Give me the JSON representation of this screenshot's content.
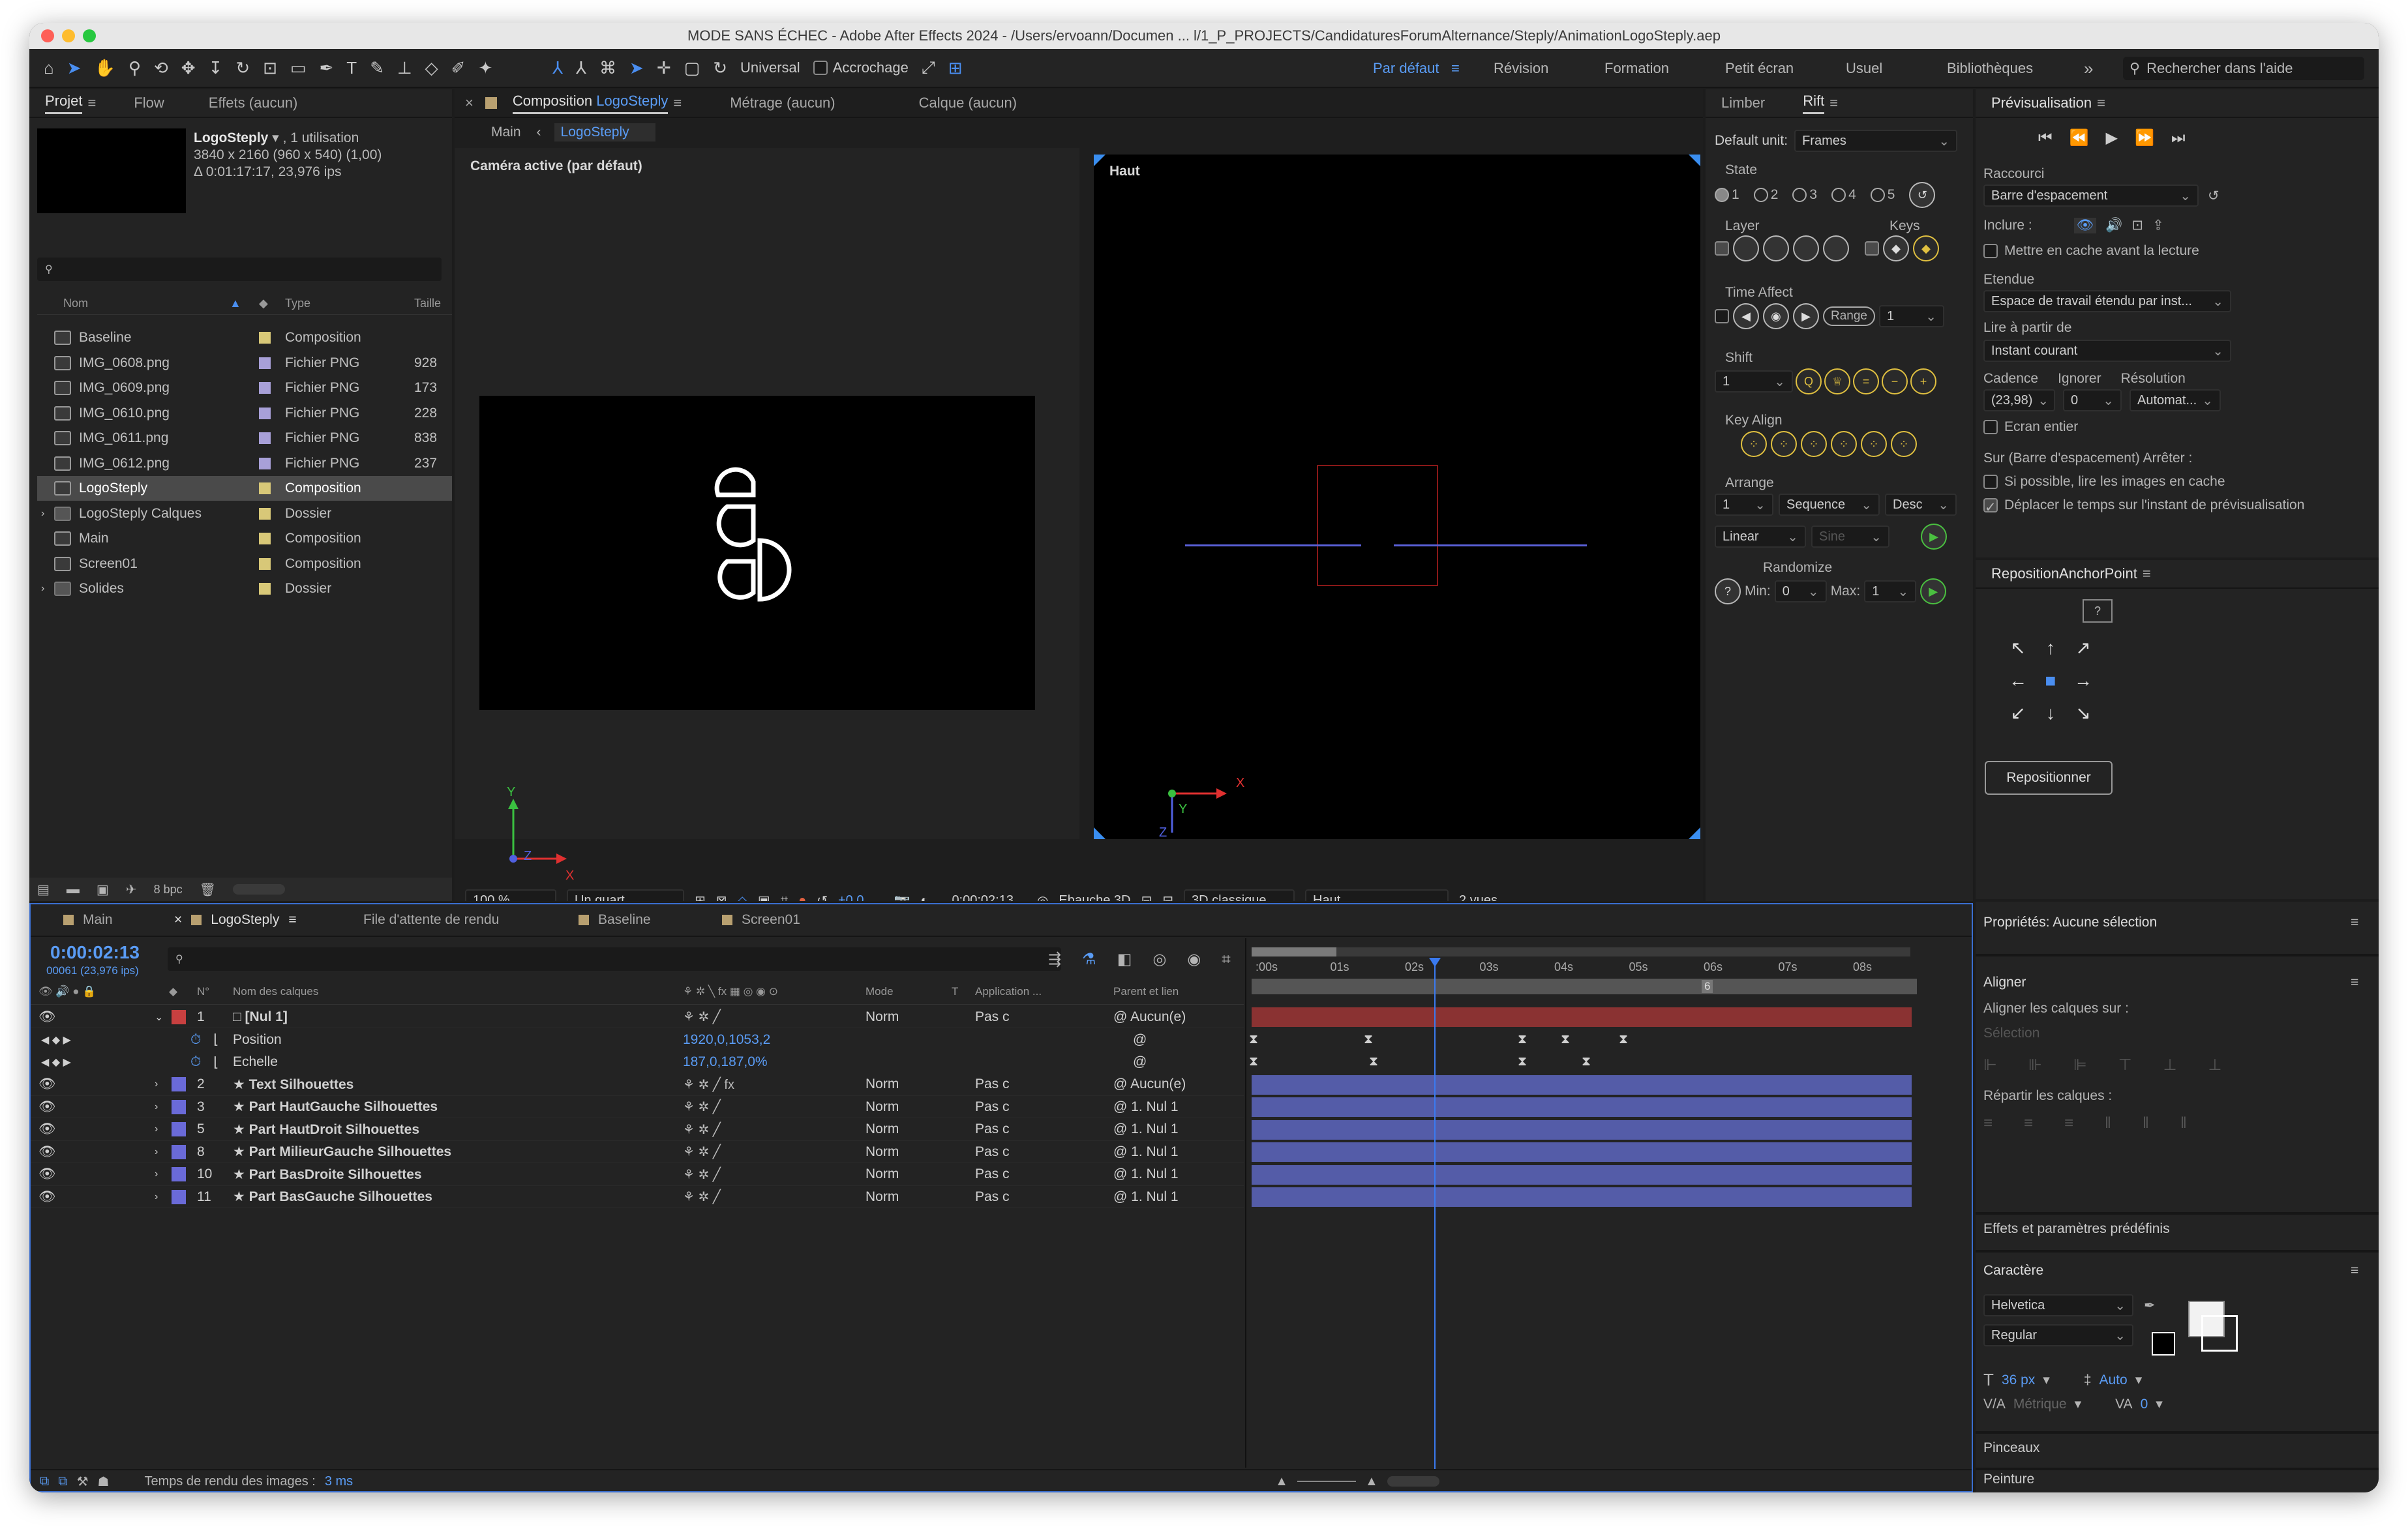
{
  "window": {
    "title": "MODE SANS ÉCHEC - Adobe After Effects 2024 - /Users/ervoann/Documen ... l/1_P_PROJECTS/CandidaturesForumAlternance/Steply/AnimationLogoSteply.aep"
  },
  "toolbar": {
    "universal": "Universal",
    "snapping": "Accrochage"
  },
  "workspaces": {
    "items": [
      "Par défaut",
      "Révision",
      "Formation",
      "Petit écran",
      "Usuel",
      "Bibliothèques"
    ],
    "search_placeholder": "Rechercher dans l'aide"
  },
  "project": {
    "tabs": [
      "Projet",
      "Flow",
      "Effets (aucun)"
    ],
    "selected_name": "LogoSteply",
    "selected_usage": ", 1 utilisation",
    "selected_dims": "3840 x 2160 (960 x 540) (1,00)",
    "selected_duration": "Δ 0:01:17:17, 23,976 ips",
    "columns": {
      "name": "Nom",
      "type": "Type",
      "size": "Taille"
    },
    "items": [
      {
        "name": "Baseline",
        "type": "Composition",
        "size": ""
      },
      {
        "name": "IMG_0608.png",
        "type": "Fichier PNG",
        "size": "928"
      },
      {
        "name": "IMG_0609.png",
        "type": "Fichier PNG",
        "size": "173"
      },
      {
        "name": "IMG_0610.png",
        "type": "Fichier PNG",
        "size": "228"
      },
      {
        "name": "IMG_0611.png",
        "type": "Fichier PNG",
        "size": "838"
      },
      {
        "name": "IMG_0612.png",
        "type": "Fichier PNG",
        "size": "237"
      },
      {
        "name": "LogoSteply",
        "type": "Composition",
        "size": ""
      },
      {
        "name": "LogoSteply Calques",
        "type": "Dossier",
        "size": ""
      },
      {
        "name": "Main",
        "type": "Composition",
        "size": ""
      },
      {
        "name": "Screen01",
        "type": "Composition",
        "size": ""
      },
      {
        "name": "Solides",
        "type": "Dossier",
        "size": ""
      }
    ],
    "bpc": "8 bpc"
  },
  "composition": {
    "tab_label": "Composition",
    "tab_comp": "LogoSteply",
    "footage": "Métrage (aucun)",
    "layer": "Calque (aucun)",
    "breadcrumb": [
      "Main",
      "LogoSteply"
    ],
    "view_left": "Caméra active (par défaut)",
    "view_right": "Haut",
    "zoom": "100 %",
    "resolution": "Un quart",
    "exposure": "+0,0",
    "timecode": "0:00:02:13",
    "draft3d": "Ebauche 3D",
    "renderer": "3D classique",
    "view_select": "Haut",
    "views": "2 vues",
    "axis": {
      "x": "X",
      "y": "Y",
      "z": "Z"
    }
  },
  "rift": {
    "tabs": [
      "Limber",
      "Rift"
    ],
    "default_unit_label": "Default unit:",
    "default_unit": "Frames",
    "state_label": "State",
    "states": [
      "1",
      "2",
      "3",
      "4",
      "5"
    ],
    "layer_label": "Layer",
    "keys_label": "Keys",
    "time_affect_label": "Time Affect",
    "range_label": "Range",
    "range_value": "1",
    "shift_label": "Shift",
    "shift_value": "1",
    "key_align_label": "Key Align",
    "arrange_label": "Arrange",
    "arrange_value": "1",
    "arrange_mode": "Sequence",
    "arrange_order": "Desc",
    "interp": "Linear",
    "interp2": "Sine",
    "randomize_label": "Randomize",
    "min_label": "Min:",
    "min_value": "0",
    "max_label": "Max:",
    "max_value": "1"
  },
  "preview": {
    "title": "Prévisualisation",
    "shortcut_label": "Raccourci",
    "shortcut": "Barre d'espacement",
    "include_label": "Inclure :",
    "cache_label": "Mettre en cache avant la lecture",
    "extent_label": "Etendue",
    "extent": "Espace de travail étendu par inst...",
    "playfrom_label": "Lire à partir de",
    "playfrom": "Instant courant",
    "fps_label": "Cadence",
    "skip_label": "Ignorer",
    "res_label": "Résolution",
    "fps": "(23,98)",
    "skip": "0",
    "res": "Automat...",
    "fullscreen": "Ecran entier",
    "stop_label": "Sur (Barre d'espacement) Arrêter :",
    "stop_opt1": "Si possible, lire les images en cache",
    "stop_opt2": "Déplacer le temps sur l'instant de prévisualisation"
  },
  "anchor": {
    "title": "RepositionAnchorPoint",
    "help": "?",
    "button": "Repositionner"
  },
  "props": {
    "title": "Propriétés: Aucune sélection",
    "align_title": "Aligner",
    "align_to": "Aligner les calques sur :",
    "align_sel": "Sélection",
    "distribute": "Répartir les calques :",
    "effects": "Effets et paramètres prédéfinis",
    "char_title": "Caractère",
    "font": "Helvetica",
    "style": "Regular",
    "size": "36 px",
    "leading": "Auto",
    "metric": "Métrique",
    "tracking": "0",
    "brushes": "Pinceaux",
    "paint": "Peinture"
  },
  "timeline": {
    "tabs": [
      "Main",
      "LogoSteply",
      "File d'attente de rendu",
      "Baseline",
      "Screen01"
    ],
    "timecode": "0:00:02:13",
    "frames": "00061 (23,976 ips)",
    "col_num": "N°",
    "col_name": "Nom des calques",
    "col_mode": "Mode",
    "col_t": "T",
    "col_app": "Application ...",
    "col_parent": "Parent et lien",
    "ruler": [
      ":00s",
      "01s",
      "02s",
      "03s",
      "04s",
      "05s",
      "06s",
      "07s",
      "08s"
    ],
    "marker": "6",
    "layers": [
      {
        "num": "1",
        "name": "[Nul 1]",
        "mode": "Norm",
        "app": "Pas c",
        "parent": "Aucun(e)",
        "color": "#c84040"
      },
      {
        "num": "2",
        "name": "Text Silhouettes",
        "mode": "Norm",
        "app": "Pas c",
        "parent": "Aucun(e)",
        "color": "#6a6ad8"
      },
      {
        "num": "3",
        "name": "Part HautGauche Silhouettes",
        "mode": "Norm",
        "app": "Pas c",
        "parent": "1. Nul 1",
        "color": "#6a6ad8"
      },
      {
        "num": "5",
        "name": "Part HautDroit Silhouettes",
        "mode": "Norm",
        "app": "Pas c",
        "parent": "1. Nul 1",
        "color": "#6a6ad8"
      },
      {
        "num": "8",
        "name": "Part MilieurGauche Silhouettes",
        "mode": "Norm",
        "app": "Pas c",
        "parent": "1. Nul 1",
        "color": "#6a6ad8"
      },
      {
        "num": "10",
        "name": "Part BasDroite Silhouettes",
        "mode": "Norm",
        "app": "Pas c",
        "parent": "1. Nul 1",
        "color": "#6a6ad8"
      },
      {
        "num": "11",
        "name": "Part BasGauche Silhouettes",
        "mode": "Norm",
        "app": "Pas c",
        "parent": "1. Nul 1",
        "color": "#6a6ad8"
      }
    ],
    "position_label": "Position",
    "position_value": "1920,0,1053,2",
    "scale_label": "Echelle",
    "scale_value": "187,0,187,0%",
    "render_time_label": "Temps de rendu des images :",
    "render_time": "3 ms"
  }
}
